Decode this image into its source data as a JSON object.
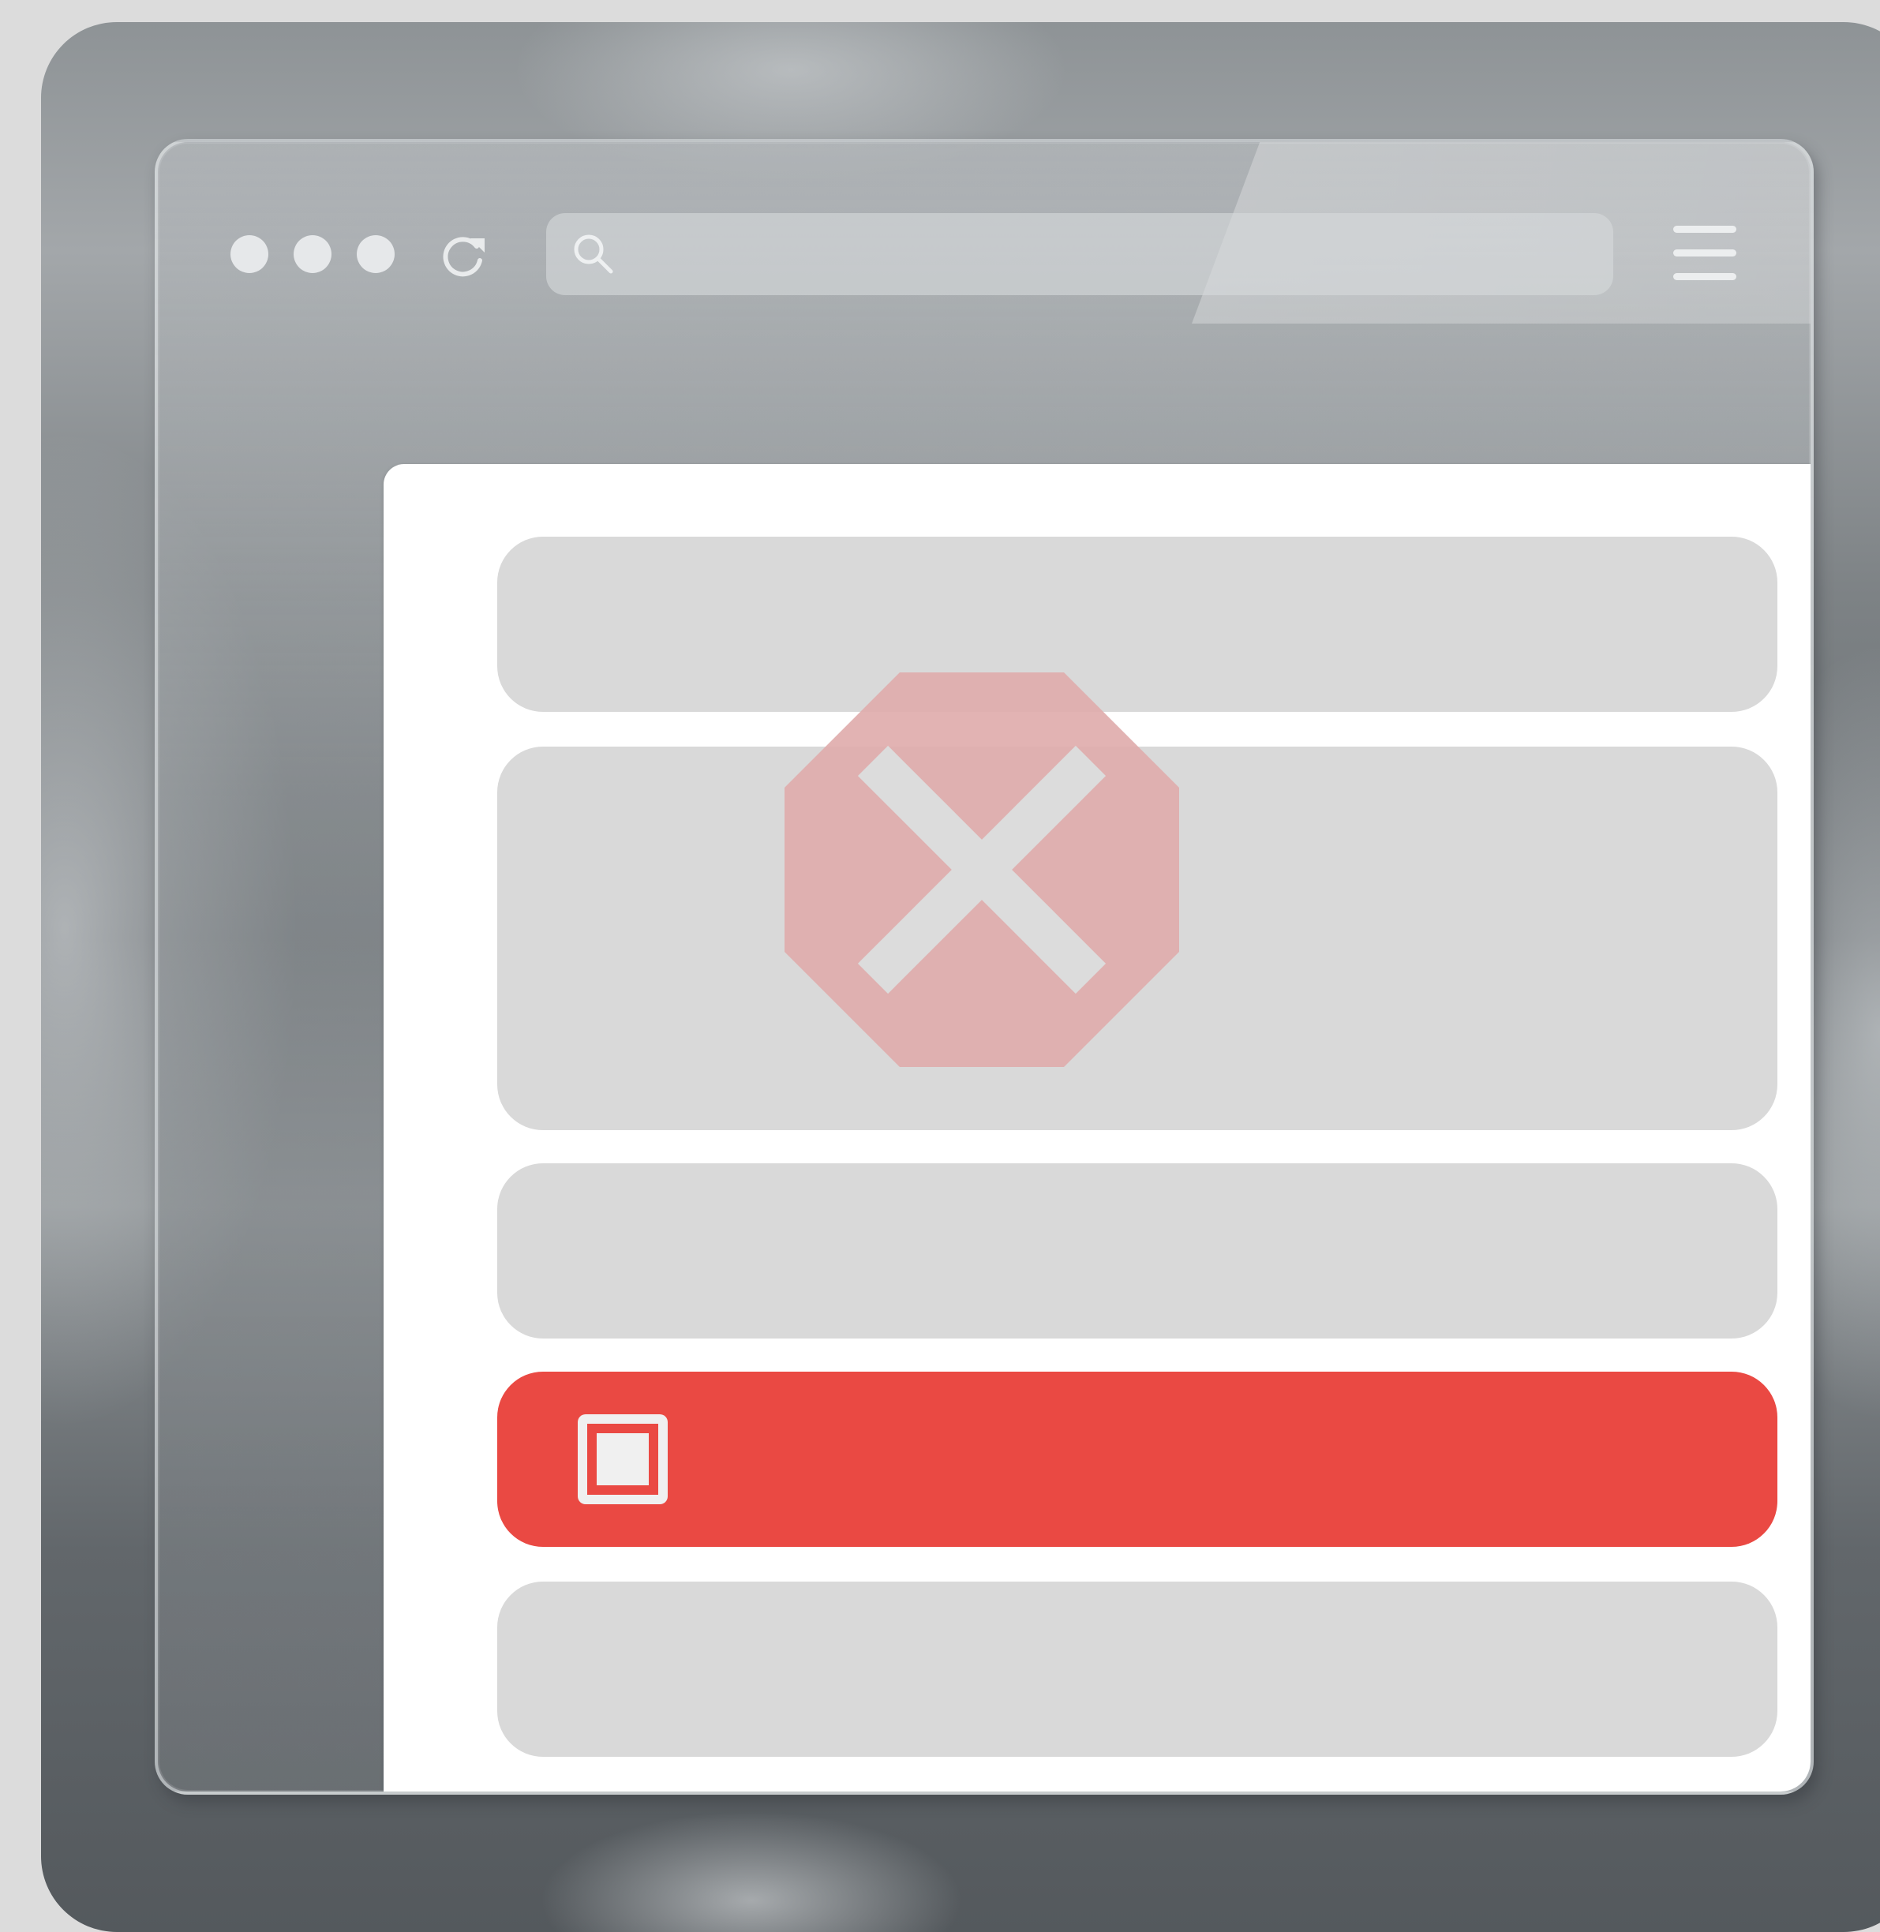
{
  "browser": {
    "address_text": "",
    "controls": [
      "window-dot",
      "window-dot",
      "window-dot",
      "reload-icon",
      "search-icon",
      "menu-icon"
    ]
  },
  "page": {
    "blocks": 5,
    "highlighted_row_label": "",
    "status_icon": "stop-x-icon"
  },
  "colors": {
    "error_red": "#ea4943",
    "stop_icon": "#e0adad",
    "placeholder_gray": "#d9d9d9"
  }
}
